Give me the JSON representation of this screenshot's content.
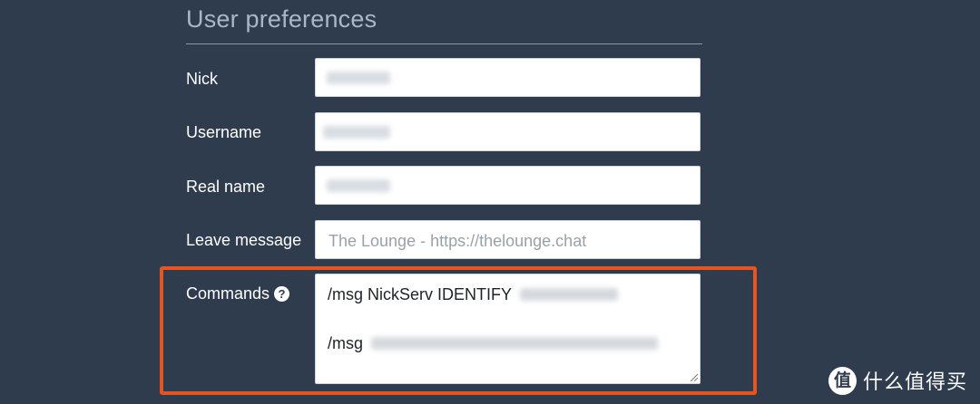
{
  "section": {
    "title": "User preferences"
  },
  "fields": {
    "nick": {
      "label": "Nick"
    },
    "username": {
      "label": "Username"
    },
    "realname": {
      "label": "Real name"
    },
    "leave_message": {
      "label": "Leave message",
      "placeholder": "The Lounge - https://thelounge.chat"
    },
    "commands": {
      "label": "Commands",
      "help_icon": "question-circle-icon",
      "line1_prefix": "/msg NickServ IDENTIFY",
      "line2_prefix": "/msg"
    }
  },
  "watermark": {
    "text": "什么值得买"
  },
  "colors": {
    "background": "#2f3c4e",
    "highlight": "#e9541e",
    "title": "#a9b7c8"
  }
}
